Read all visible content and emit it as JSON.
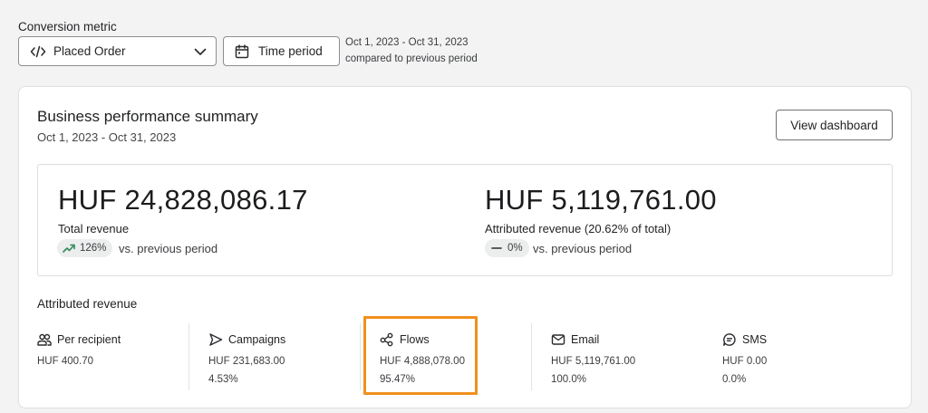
{
  "conversion_metric": {
    "label": "Conversion metric",
    "selected": "Placed Order",
    "time_period_button": "Time period",
    "date_range": "Oct 1, 2023 - Oct 31, 2023",
    "comparison_text": "compared to previous period"
  },
  "summary": {
    "title": "Business performance summary",
    "date_range": "Oct 1, 2023 - Oct 31, 2023",
    "view_dashboard": "View dashboard",
    "total_revenue": {
      "value": "HUF 24,828,086.17",
      "label": "Total revenue",
      "change": "126%",
      "change_icon": "trend-up-icon",
      "vs_text": "vs. previous period"
    },
    "attributed_revenue": {
      "value": "HUF 5,119,761.00",
      "label": "Attributed revenue (20.62% of total)",
      "change": "0%",
      "change_icon": "dash-icon",
      "vs_text": "vs. previous period"
    }
  },
  "attributed": {
    "title": "Attributed revenue",
    "columns": [
      {
        "label": "Per recipient",
        "icon": "users-icon",
        "value": "HUF 400.70",
        "percent": ""
      },
      {
        "label": "Campaigns",
        "icon": "send-icon",
        "value": "HUF 231,683.00",
        "percent": "4.53%"
      },
      {
        "label": "Flows",
        "icon": "flows-icon",
        "value": "HUF 4,888,078.00",
        "percent": "95.47%"
      },
      {
        "label": "Email",
        "icon": "mail-icon",
        "value": "HUF 5,119,761.00",
        "percent": "100.0%"
      },
      {
        "label": "SMS",
        "icon": "sms-icon",
        "value": "HUF 0.00",
        "percent": "0.0%"
      }
    ]
  },
  "colors": {
    "highlight": "#f0901e",
    "trend_up": "#2f8a5a"
  }
}
